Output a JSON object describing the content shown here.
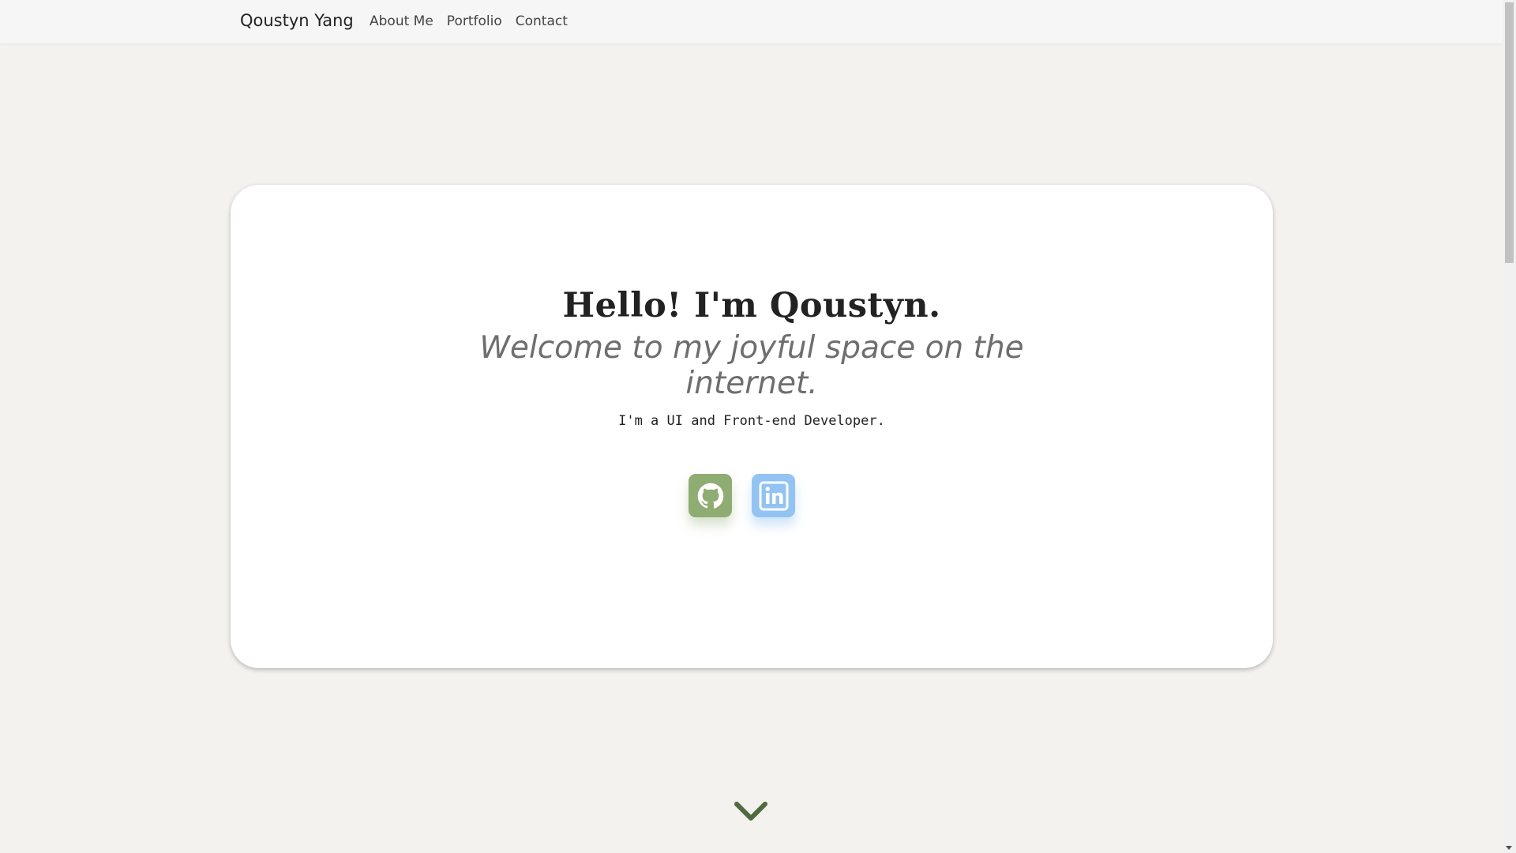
{
  "navbar": {
    "brand": "Qoustyn Yang",
    "links": [
      "About Me",
      "Portfolio",
      "Contact"
    ]
  },
  "hero": {
    "title": "Hello! I'm Qoustyn.",
    "subtitle": "Welcome to my joyful space on the internet.",
    "role": "I'm a UI and Front-end Developer."
  },
  "social": {
    "github_icon": "github-icon",
    "linkedin_icon": "linkedin-icon"
  },
  "scroll_icon": "chevron-down-icon",
  "colors": {
    "background": "#f3f2ef",
    "navbar": "#f6f6f6",
    "card": "#ffffff",
    "github": "#8fad73",
    "linkedin": "#93c3f2",
    "chevron": "#4f6a3e"
  }
}
